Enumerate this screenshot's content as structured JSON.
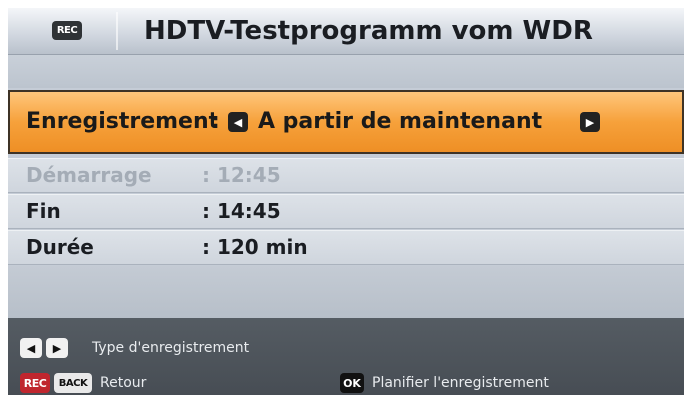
{
  "header": {
    "rec_badge": "REC",
    "title": "HDTV-Testprogramm vom WDR"
  },
  "recording_mode": {
    "label": "Enregistrement",
    "colon": ":",
    "value": "A partir de maintenant",
    "left_arrow": "◀",
    "right_arrow": "▶"
  },
  "details": {
    "start": {
      "label": "Démarrage",
      "value": ": 12:45",
      "enabled": false
    },
    "end": {
      "label": "Fin",
      "value": ": 14:45"
    },
    "duration": {
      "label": "Durée",
      "value": ": 120 min"
    }
  },
  "footer": {
    "left_key": "◀",
    "right_key": "▶",
    "type_hint": "Type d'enregistrement",
    "rec_key": "REC",
    "back_key": "BACK",
    "back_hint": "Retour",
    "ok_key": "OK",
    "schedule_hint": "Planifier l'enregistrement"
  },
  "colors": {
    "highlight": "#f6a13b",
    "footer_bg": "#4e555c",
    "panel_bg": "#c5ccd6",
    "rec_key": "#c0262e"
  }
}
